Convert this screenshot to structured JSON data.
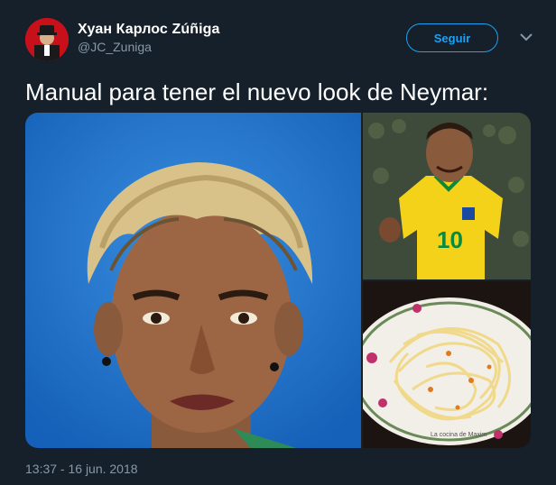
{
  "user": {
    "display_name": "Хуан Карлос Zúñiga",
    "handle": "@JC_Zuniga"
  },
  "actions": {
    "follow_label": "Seguir",
    "more_icon": "chevron-down-icon"
  },
  "tweet": {
    "text": "Manual para tener el nuevo look de Neymar:",
    "timestamp": "13:37 - 16 jun. 2018"
  },
  "media": {
    "watermark": "La cocina de Maxim",
    "jersey_number": "10"
  },
  "colors": {
    "background": "#15202b",
    "accent": "#1da1f2",
    "muted": "#8899a6"
  }
}
